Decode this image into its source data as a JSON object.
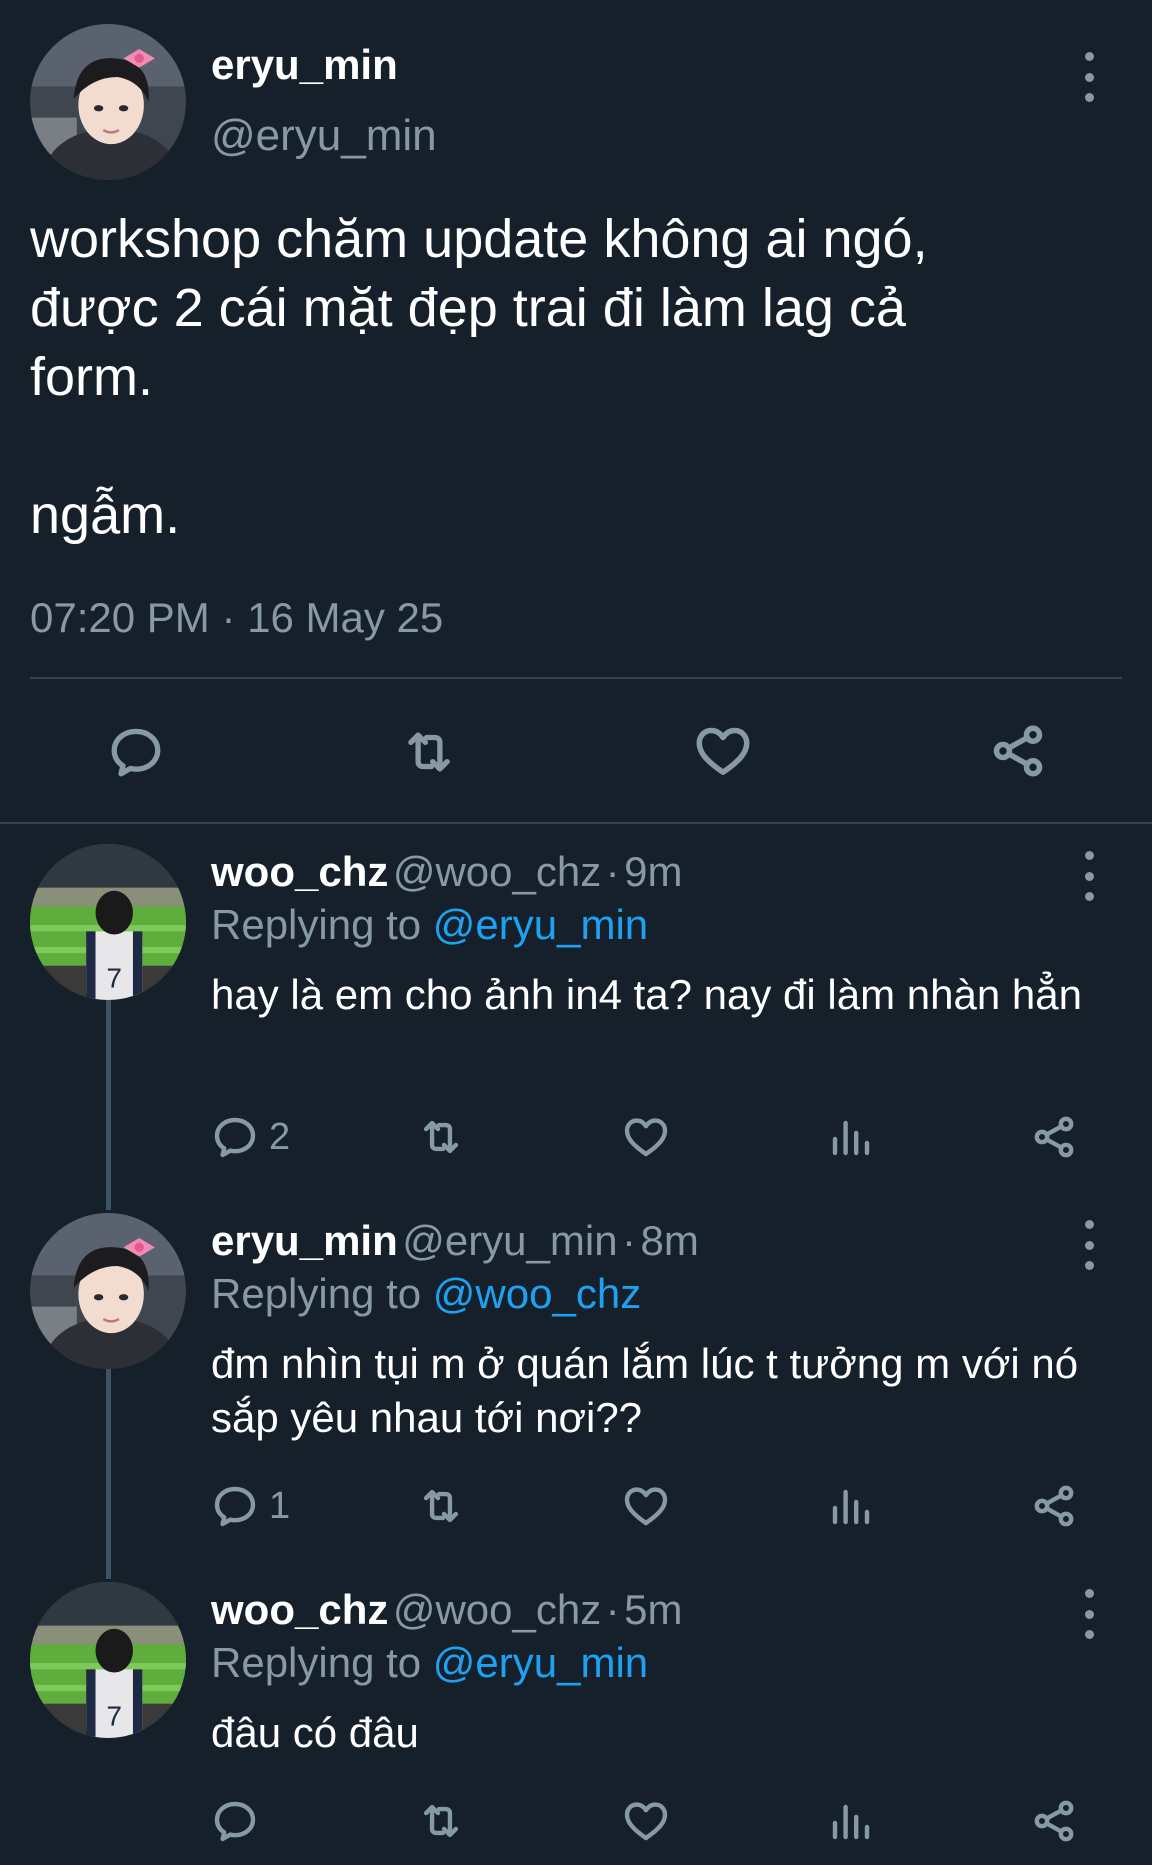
{
  "main_tweet": {
    "display_name": "eryu_min",
    "handle": "@eryu_min",
    "text_lines": [
      "workshop chăm update không ai ngó,",
      "được 2 cái mặt đẹp trai đi làm lag cả",
      "form."
    ],
    "text_after_gap": "ngẫm.",
    "timestamp": "07:20 PM · 16 May 25",
    "actions": [
      "reply-icon",
      "retweet-icon",
      "like-icon",
      "share-icon"
    ]
  },
  "replies": [
    {
      "display_name": "woo_chz",
      "handle": "@woo_chz",
      "separator": "·",
      "time": "9m",
      "replying_prefix": "Replying to",
      "replying_to": "@eryu_min",
      "text": "hay là em cho ảnh in4 ta? nay đi làm nhàn hẳn",
      "reply_count": "2"
    },
    {
      "display_name": "eryu_min",
      "handle": "@eryu_min",
      "separator": "·",
      "time": "8m",
      "replying_prefix": "Replying to",
      "replying_to": "@woo_chz",
      "text": "đm nhìn tụi m ở quán lắm lúc t tưởng m với nó sắp yêu nhau tới nơi??",
      "reply_count": "1"
    },
    {
      "display_name": "woo_chz",
      "handle": "@woo_chz",
      "separator": "·",
      "time": "5m",
      "replying_prefix": "Replying to",
      "replying_to": "@eryu_min",
      "text": "đâu có đâu",
      "reply_count": ""
    }
  ],
  "colors": {
    "background": "#15202b",
    "text_primary": "#ffffff",
    "text_secondary": "#8899a6",
    "mention": "#1da1f2",
    "divider": "#38444d"
  }
}
